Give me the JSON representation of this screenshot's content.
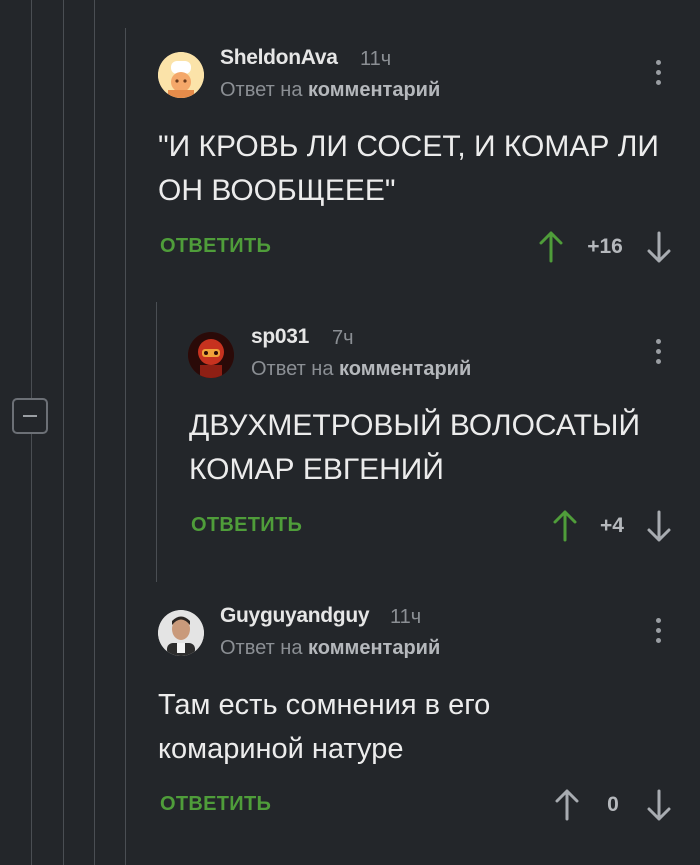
{
  "comments": [
    {
      "author": "SheldonAva",
      "time": "11ч",
      "reply_prefix": "Ответ на",
      "reply_link": "комментарий",
      "text": "\"И КРОВЬ ЛИ СОСЕТ, И КОМАР ЛИ ОН ВООБЩЕЕЕ\"",
      "answer_label": "ОТВЕТИТЬ",
      "score": "+16",
      "upvoted": true
    },
    {
      "author": "sp031",
      "time": "7ч",
      "reply_prefix": "Ответ на",
      "reply_link": "комментарий",
      "text": "ДВУХМЕТРОВЫЙ ВОЛОСАТЫЙ КОМАР ЕВГЕНИЙ",
      "answer_label": "ОТВЕТИТЬ",
      "score": "+4",
      "upvoted": true
    },
    {
      "author": "Guyguyandguy",
      "time": "11ч",
      "reply_prefix": "Ответ на",
      "reply_link": "комментарий",
      "text": "Там есть сомнения в его комариной натуре",
      "answer_label": "ОТВЕТИТЬ",
      "score": "0",
      "upvoted": false
    }
  ],
  "colors": {
    "background": "#23262a",
    "accent_green": "#4f9d3a",
    "muted": "#8b8f94"
  }
}
